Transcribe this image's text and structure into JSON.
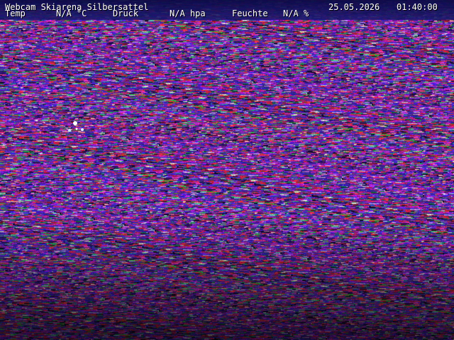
{
  "overlay": {
    "title": "Webcam Skiarena Silbersattel",
    "date": "25.05.2026",
    "time": "01:40:00",
    "temp_label": "Temp",
    "temp_value": "N/A °C",
    "pressure_label": "Druck",
    "pressure_value": "N/A hpa",
    "humidity_label": "Feuchte",
    "humidity_value": "N/A %"
  },
  "colors": {
    "noise_dominant": "#3a2a9a",
    "noise_magenta": "#b030b0",
    "noise_red": "#c02040",
    "noise_green": "#20a060",
    "overlay_text": "#ffffff"
  }
}
